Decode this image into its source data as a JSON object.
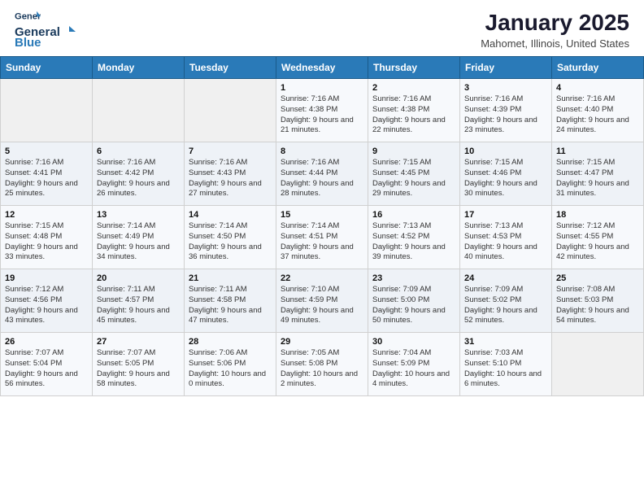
{
  "header": {
    "logo_line1": "General",
    "logo_line2": "Blue",
    "title": "January 2025",
    "subtitle": "Mahomet, Illinois, United States"
  },
  "weekdays": [
    "Sunday",
    "Monday",
    "Tuesday",
    "Wednesday",
    "Thursday",
    "Friday",
    "Saturday"
  ],
  "weeks": [
    [
      {
        "day": "",
        "info": ""
      },
      {
        "day": "",
        "info": ""
      },
      {
        "day": "",
        "info": ""
      },
      {
        "day": "1",
        "info": "Sunrise: 7:16 AM\nSunset: 4:38 PM\nDaylight: 9 hours and 21 minutes."
      },
      {
        "day": "2",
        "info": "Sunrise: 7:16 AM\nSunset: 4:38 PM\nDaylight: 9 hours and 22 minutes."
      },
      {
        "day": "3",
        "info": "Sunrise: 7:16 AM\nSunset: 4:39 PM\nDaylight: 9 hours and 23 minutes."
      },
      {
        "day": "4",
        "info": "Sunrise: 7:16 AM\nSunset: 4:40 PM\nDaylight: 9 hours and 24 minutes."
      }
    ],
    [
      {
        "day": "5",
        "info": "Sunrise: 7:16 AM\nSunset: 4:41 PM\nDaylight: 9 hours and 25 minutes."
      },
      {
        "day": "6",
        "info": "Sunrise: 7:16 AM\nSunset: 4:42 PM\nDaylight: 9 hours and 26 minutes."
      },
      {
        "day": "7",
        "info": "Sunrise: 7:16 AM\nSunset: 4:43 PM\nDaylight: 9 hours and 27 minutes."
      },
      {
        "day": "8",
        "info": "Sunrise: 7:16 AM\nSunset: 4:44 PM\nDaylight: 9 hours and 28 minutes."
      },
      {
        "day": "9",
        "info": "Sunrise: 7:15 AM\nSunset: 4:45 PM\nDaylight: 9 hours and 29 minutes."
      },
      {
        "day": "10",
        "info": "Sunrise: 7:15 AM\nSunset: 4:46 PM\nDaylight: 9 hours and 30 minutes."
      },
      {
        "day": "11",
        "info": "Sunrise: 7:15 AM\nSunset: 4:47 PM\nDaylight: 9 hours and 31 minutes."
      }
    ],
    [
      {
        "day": "12",
        "info": "Sunrise: 7:15 AM\nSunset: 4:48 PM\nDaylight: 9 hours and 33 minutes."
      },
      {
        "day": "13",
        "info": "Sunrise: 7:14 AM\nSunset: 4:49 PM\nDaylight: 9 hours and 34 minutes."
      },
      {
        "day": "14",
        "info": "Sunrise: 7:14 AM\nSunset: 4:50 PM\nDaylight: 9 hours and 36 minutes."
      },
      {
        "day": "15",
        "info": "Sunrise: 7:14 AM\nSunset: 4:51 PM\nDaylight: 9 hours and 37 minutes."
      },
      {
        "day": "16",
        "info": "Sunrise: 7:13 AM\nSunset: 4:52 PM\nDaylight: 9 hours and 39 minutes."
      },
      {
        "day": "17",
        "info": "Sunrise: 7:13 AM\nSunset: 4:53 PM\nDaylight: 9 hours and 40 minutes."
      },
      {
        "day": "18",
        "info": "Sunrise: 7:12 AM\nSunset: 4:55 PM\nDaylight: 9 hours and 42 minutes."
      }
    ],
    [
      {
        "day": "19",
        "info": "Sunrise: 7:12 AM\nSunset: 4:56 PM\nDaylight: 9 hours and 43 minutes."
      },
      {
        "day": "20",
        "info": "Sunrise: 7:11 AM\nSunset: 4:57 PM\nDaylight: 9 hours and 45 minutes."
      },
      {
        "day": "21",
        "info": "Sunrise: 7:11 AM\nSunset: 4:58 PM\nDaylight: 9 hours and 47 minutes."
      },
      {
        "day": "22",
        "info": "Sunrise: 7:10 AM\nSunset: 4:59 PM\nDaylight: 9 hours and 49 minutes."
      },
      {
        "day": "23",
        "info": "Sunrise: 7:09 AM\nSunset: 5:00 PM\nDaylight: 9 hours and 50 minutes."
      },
      {
        "day": "24",
        "info": "Sunrise: 7:09 AM\nSunset: 5:02 PM\nDaylight: 9 hours and 52 minutes."
      },
      {
        "day": "25",
        "info": "Sunrise: 7:08 AM\nSunset: 5:03 PM\nDaylight: 9 hours and 54 minutes."
      }
    ],
    [
      {
        "day": "26",
        "info": "Sunrise: 7:07 AM\nSunset: 5:04 PM\nDaylight: 9 hours and 56 minutes."
      },
      {
        "day": "27",
        "info": "Sunrise: 7:07 AM\nSunset: 5:05 PM\nDaylight: 9 hours and 58 minutes."
      },
      {
        "day": "28",
        "info": "Sunrise: 7:06 AM\nSunset: 5:06 PM\nDaylight: 10 hours and 0 minutes."
      },
      {
        "day": "29",
        "info": "Sunrise: 7:05 AM\nSunset: 5:08 PM\nDaylight: 10 hours and 2 minutes."
      },
      {
        "day": "30",
        "info": "Sunrise: 7:04 AM\nSunset: 5:09 PM\nDaylight: 10 hours and 4 minutes."
      },
      {
        "day": "31",
        "info": "Sunrise: 7:03 AM\nSunset: 5:10 PM\nDaylight: 10 hours and 6 minutes."
      },
      {
        "day": "",
        "info": ""
      }
    ]
  ]
}
